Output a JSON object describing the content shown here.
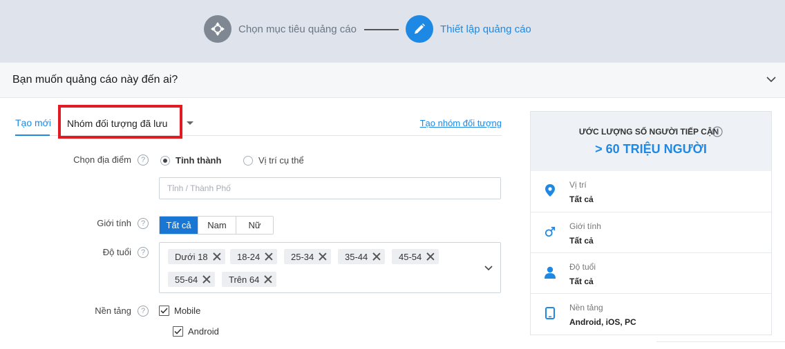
{
  "stepper": {
    "step1_label": "Chọn mục tiêu quảng cáo",
    "step1_icon": "crosshair-move-icon",
    "step2_label": "Thiết lập quảng cáo",
    "step2_icon": "pencil-icon"
  },
  "section": {
    "title": "Bạn muốn quảng cáo này đến ai?"
  },
  "tabs": {
    "new_label": "Tạo mới",
    "saved_label": "Nhóm đối tượng đã lưu",
    "create_link": "Tạo nhóm đối tượng"
  },
  "location": {
    "label": "Chọn địa điểm",
    "option_province": "Tỉnh thành",
    "option_specific": "Vị trí cụ thể",
    "selected": "Tỉnh thành",
    "input_placeholder": "Tỉnh / Thành Phố"
  },
  "gender": {
    "label": "Giới tính",
    "options": [
      "Tất cả",
      "Nam",
      "Nữ"
    ],
    "selected": "Tất cả"
  },
  "age": {
    "label": "Độ tuổi",
    "chips": [
      "Dưới 18",
      "18-24",
      "25-34",
      "35-44",
      "45-54",
      "55-64",
      "Trên 64"
    ]
  },
  "platform": {
    "label": "Nền tảng",
    "mobile_label": "Mobile",
    "mobile_checked": true,
    "android_label": "Android",
    "android_checked": true
  },
  "estimate": {
    "title": "ƯỚC LƯỢNG SỐ NGƯỜI TIẾP CẬN",
    "value": "> 60 TRIỆU NGƯỜI",
    "rows": [
      {
        "label": "Vị trí",
        "value": "Tất cả",
        "icon": "location-pin-icon"
      },
      {
        "label": "Giới tính",
        "value": "Tất cả",
        "icon": "gender-male-icon"
      },
      {
        "label": "Độ tuổi",
        "value": "Tất cả",
        "icon": "person-icon"
      },
      {
        "label": "Nền tảng",
        "value": "Android, iOS, PC",
        "icon": "tablet-icon"
      }
    ]
  },
  "colors": {
    "accent": "#1e88e5",
    "highlight_border": "#e21b23",
    "header_bg": "#dfe4ec"
  }
}
